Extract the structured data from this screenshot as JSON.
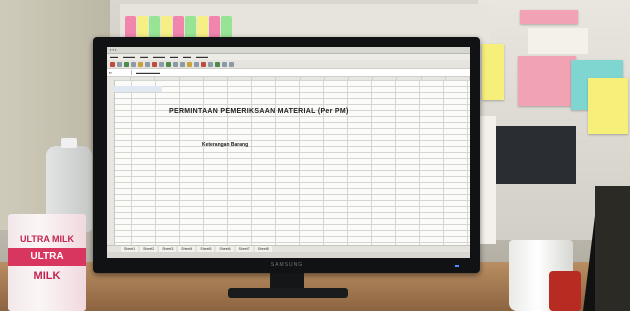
{
  "scene": "Photo of an office desk with a monitor showing a spreadsheet",
  "monitor": {
    "brand": "SAMSUNG"
  },
  "spreadsheet": {
    "form_title": "PERMINTAAN PEMERIKSAAN MATERIAL (Per PM)",
    "section_title": "Keterangan Barang",
    "sheet_tabs": [
      "Sheet1",
      "Sheet2",
      "Sheet3",
      "Sheet4",
      "Sheet5",
      "Sheet6",
      "Sheet7",
      "Sheet8"
    ]
  },
  "products": {
    "milk_carton_top": "ULTRA MILK",
    "milk_carton_band": "ULTRA",
    "milk_carton_bottom": "MILK"
  },
  "colors": {
    "bezel": "#111214",
    "milk_brand": "#d8355f",
    "sticky_pink": "#f2a3b3",
    "sticky_yellow": "#f6ef7a",
    "sticky_teal": "#7fd6d1"
  }
}
